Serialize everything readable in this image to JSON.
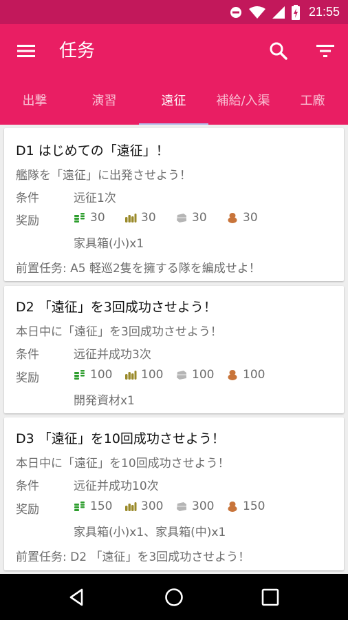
{
  "status_bar": {
    "time": "21:55",
    "icons": [
      "do-not-disturb-icon",
      "wifi-icon",
      "cell-signal-icon",
      "battery-charging-icon"
    ]
  },
  "app_bar": {
    "title": "任务",
    "menu_icon": "menu-icon",
    "search_icon": "search-icon",
    "filter_icon": "filter-icon"
  },
  "tabs": [
    {
      "label": "出撃",
      "active": false
    },
    {
      "label": "演習",
      "active": false
    },
    {
      "label": "遠征",
      "active": true
    },
    {
      "label": "補給/入渠",
      "active": false
    },
    {
      "label": "工廠",
      "active": false
    }
  ],
  "labels": {
    "condition": "条件",
    "reward": "奖励",
    "prerequisite_prefix": "前置任务: "
  },
  "resource_icons": [
    "fuel-icon",
    "ammo-icon",
    "steel-icon",
    "bauxite-icon"
  ],
  "colors": {
    "primary": "#e91e63",
    "status_bar": "#c2185b",
    "tab_indicator": "#b3b6e8",
    "fuel": "#2e9e2e",
    "ammo": "#9a8a2a",
    "steel": "#b5b5b5",
    "bauxite": "#c8743a"
  },
  "quests": [
    {
      "title": "D1 はじめての「遠征」！",
      "description": "艦隊を「遠征」に出発させよう！",
      "condition": "远征1次",
      "rewards": {
        "fuel": "30",
        "ammo": "30",
        "steel": "30",
        "bauxite": "30"
      },
      "items": "家具箱(小)x1",
      "prerequisite": "A5 軽巡2隻を擁する隊を編成せよ！"
    },
    {
      "title": "D2 「遠征」を3回成功させよう！",
      "description": "本日中に「遠征」を3回成功させよう！",
      "condition": "远征并成功3次",
      "rewards": {
        "fuel": "100",
        "ammo": "100",
        "steel": "100",
        "bauxite": "100"
      },
      "items": "開発資材x1",
      "prerequisite": null
    },
    {
      "title": "D3 「遠征」を10回成功させよう！",
      "description": "本日中に「遠征」を10回成功させよう！",
      "condition": "远征并成功10次",
      "rewards": {
        "fuel": "150",
        "ammo": "300",
        "steel": "300",
        "bauxite": "150"
      },
      "items": "家具箱(小)x1、家具箱(中)x1",
      "prerequisite": "D2 「遠征」を3回成功させよう！"
    }
  ],
  "nav_bar": {
    "icons": [
      "back-icon",
      "home-icon",
      "recents-icon"
    ]
  }
}
